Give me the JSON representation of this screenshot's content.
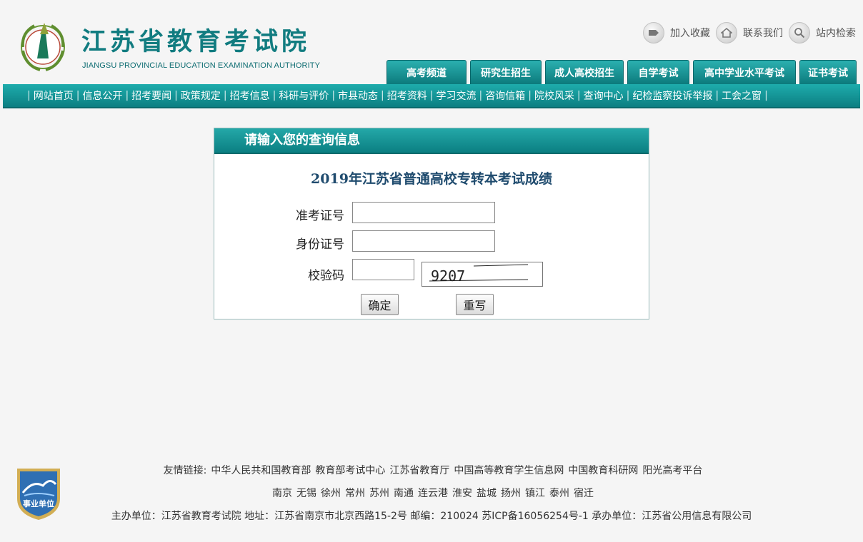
{
  "header": {
    "title": "江苏省教育考试院",
    "subtitle": "JIANGSU PROVINCIAL EDUCATION EXAMINATION AUTHORITY",
    "toplinks": [
      {
        "label": "加入收藏",
        "icon": "bookmark-icon"
      },
      {
        "label": "联系我们",
        "icon": "home-icon"
      },
      {
        "label": "站内检索",
        "icon": "search-icon"
      }
    ],
    "tabs": [
      "高考频道",
      "研究生招生",
      "成人高校招生",
      "自学考试",
      "高中学业水平考试",
      "证书考试"
    ]
  },
  "nav": [
    "网站首页",
    "信息公开",
    "招考要闻",
    "政策规定",
    "招考信息",
    "科研与评价",
    "市县动态",
    "招考资料",
    "学习交流",
    "咨询信箱",
    "院校风采",
    "查询中心",
    "纪检监察投诉举报",
    "工会之窗"
  ],
  "query": {
    "heading": "请输入您的查询信息",
    "title": "2019年江苏省普通高校专转本考试成绩",
    "exam_no_label": "准考证号",
    "exam_no_value": "",
    "id_label": "身份证号",
    "id_value": "",
    "code_label": "校验码",
    "code_value": "",
    "captcha_text": "9207",
    "submit_label": "确定",
    "reset_label": "重写"
  },
  "footer": {
    "links_label": "友情链接:",
    "links": [
      "中华人民共和国教育部",
      "教育部考试中心",
      "江苏省教育厅",
      "中国高等教育学生信息网",
      "中国教育科研网",
      "阳光高考平台"
    ],
    "cities": [
      "南京",
      "无锡",
      "徐州",
      "常州",
      "苏州",
      "南通",
      "连云港",
      "淮安",
      "盐城",
      "扬州",
      "镇江",
      "泰州",
      "宿迁"
    ],
    "info": "主办单位：江苏省教育考试院 地址：江苏省南京市北京西路15-2号 邮编：210024 苏ICP备16056254号-1 承办单位：江苏省公用信息有限公司",
    "badge_text": "事业单位"
  },
  "colors": {
    "accent": "#117c80",
    "nav_bg": "#0c7f82",
    "title_blue": "#1f4b6e"
  }
}
